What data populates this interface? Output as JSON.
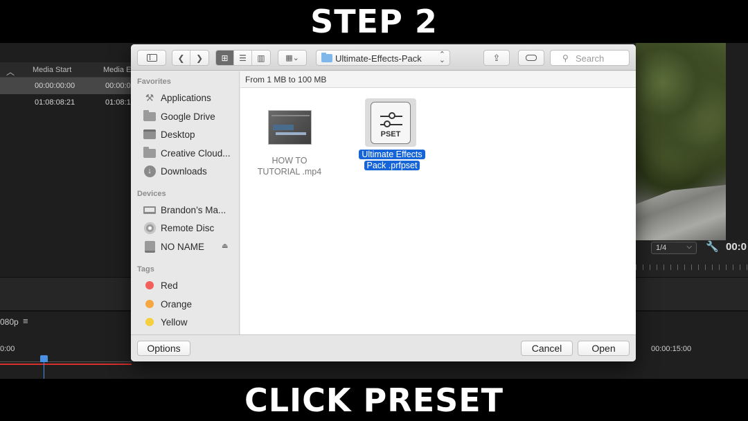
{
  "captions": {
    "top": "STEP 2",
    "bottom": "CLICK PRESET"
  },
  "editor": {
    "project_panel": {
      "columns": [
        "Media Start",
        "Media E"
      ],
      "rows": [
        {
          "media_start": "00:00:00:00",
          "media_end": "00:00:0"
        },
        {
          "media_start": "01:08:08:21",
          "media_end": "01:08:1"
        }
      ]
    },
    "program_monitor": {
      "zoom": "1/4",
      "timecode": "00:0"
    },
    "timeline": {
      "sequence_label": "080p",
      "time_left": "0:00",
      "time_right": "00:00:15:00"
    }
  },
  "dialog": {
    "toolbar": {
      "path": "Ultimate-Effects-Pack",
      "search_placeholder": "Search"
    },
    "sidebar": {
      "favorites_heading": "Favorites",
      "favorites": [
        {
          "label": "Applications",
          "icon": "applications-icon"
        },
        {
          "label": "Google Drive",
          "icon": "folder-icon"
        },
        {
          "label": "Desktop",
          "icon": "desktop-icon"
        },
        {
          "label": "Creative Cloud...",
          "icon": "folder-icon"
        },
        {
          "label": "Downloads",
          "icon": "downloads-icon"
        }
      ],
      "devices_heading": "Devices",
      "devices": [
        {
          "label": "Brandon’s Ma...",
          "icon": "laptop-icon"
        },
        {
          "label": "Remote Disc",
          "icon": "disc-icon"
        },
        {
          "label": "NO NAME",
          "icon": "drive-icon"
        }
      ],
      "tags_heading": "Tags",
      "tags": [
        {
          "label": "Red",
          "color": "#f25f5c"
        },
        {
          "label": "Orange",
          "color": "#f5a742"
        },
        {
          "label": "Yellow",
          "color": "#f5cf3d"
        }
      ]
    },
    "content": {
      "breadcrumb": "From 1 MB to 100 MB",
      "files": [
        {
          "name_line1": "HOW TO",
          "name_line2": "TUTORIAL .mp4",
          "type": "video"
        },
        {
          "name_line1": "Ultimate Effects",
          "name_line2": "Pack .prfpset",
          "type": "preset",
          "icon_label": "PSET",
          "selected": true
        }
      ]
    },
    "footer": {
      "options_label": "Options",
      "cancel_label": "Cancel",
      "open_label": "Open"
    }
  },
  "colors": {
    "selection": "#1565d8",
    "folder_accent": "#7fb7ea"
  }
}
